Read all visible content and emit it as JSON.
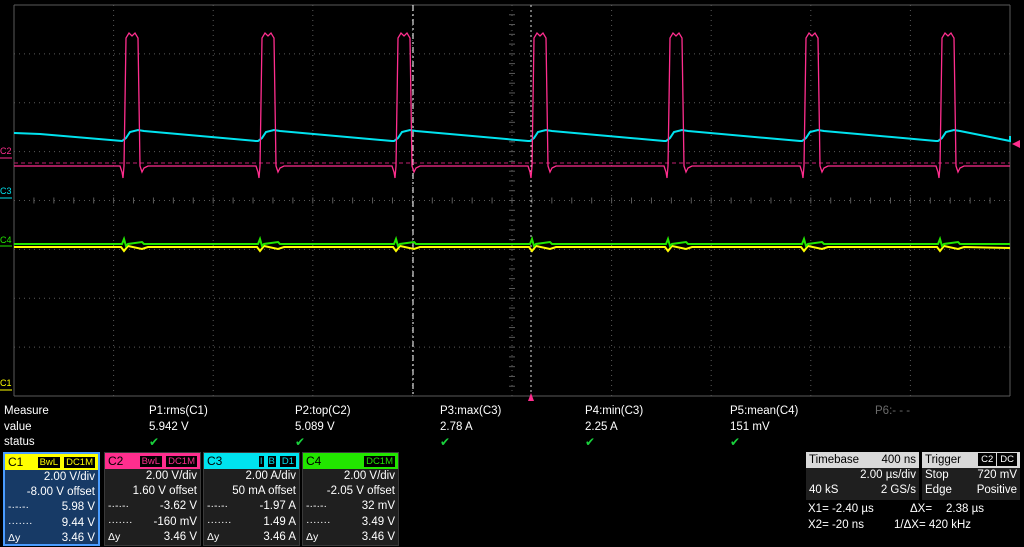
{
  "colors": {
    "c1": "#ffff00",
    "c2": "#ff2e8e",
    "c3": "#00e3ef",
    "c4": "#22e600",
    "grid": "#5a5a5a",
    "status_ok": "#19d23c"
  },
  "screen": {
    "markers": {
      "c2": "C2",
      "c3": "C3",
      "c4": "C4",
      "c1": "C1"
    }
  },
  "measure": {
    "header_label": "Measure",
    "value_label": "value",
    "status_label": "status",
    "params": [
      {
        "name": "P1:rms(C1)",
        "value": "5.942 V",
        "status": "✔"
      },
      {
        "name": "P2:top(C2)",
        "value": "5.089 V",
        "status": "✔"
      },
      {
        "name": "P3:max(C3)",
        "value": "2.78 A",
        "status": "✔"
      },
      {
        "name": "P4:min(C3)",
        "value": "2.25 A",
        "status": "✔"
      },
      {
        "name": "P5:mean(C4)",
        "value": "151 mV",
        "status": "✔"
      },
      {
        "name": "P6:- - -",
        "value": "",
        "status": ""
      }
    ]
  },
  "channels": [
    {
      "name": "C1",
      "badges": [
        "BwL",
        "DC1M"
      ],
      "vdiv": "2.00 V/div",
      "offset": "-8.00 V offset",
      "r1l": "-·-·-·",
      "r1": "5.98 V",
      "r2l": "·······",
      "r2": "9.44 V",
      "r3l": "Δy",
      "r3": "3.46 V"
    },
    {
      "name": "C2",
      "badges": [
        "BwL",
        "DC1M"
      ],
      "vdiv": "2.00 V/div",
      "offset": "1.60 V offset",
      "r1l": "-·-·-·",
      "r1": "-3.62 V",
      "r2l": "·······",
      "r2": "-160 mV",
      "r3l": "Δy",
      "r3": "3.46 V"
    },
    {
      "name": "C3",
      "badges": [
        "I",
        "B",
        "D1"
      ],
      "vdiv": "2.00 A/div",
      "offset": "50 mA offset",
      "r1l": "-·-·-·",
      "r1": "-1.97 A",
      "r2l": "·······",
      "r2": "1.49 A",
      "r3l": "Δy",
      "r3": "3.46 A"
    },
    {
      "name": "C4",
      "badges": [
        "DC1M"
      ],
      "vdiv": "2.00 V/div",
      "offset": "-2.05 V offset",
      "r1l": "-·-·-·",
      "r1": "32 mV",
      "r2l": "·······",
      "r2": "3.49 V",
      "r3l": "Δy",
      "r3": "3.46 V"
    }
  ],
  "timebase": {
    "label": "Timebase",
    "delay": "400 ns",
    "tdiv": "2.00 µs/div",
    "samples": "40 kS",
    "rate": "2 GS/s"
  },
  "trigger": {
    "label": "Trigger",
    "source": "C2",
    "coupling": "DC",
    "mode": "Stop",
    "level": "720 mV",
    "type": "Edge",
    "slope": "Positive"
  },
  "cursors": {
    "x1": "X1= -2.40 µs",
    "dx": "ΔX=",
    "dx_val": "2.38 µs",
    "x2": "X2= -20 ns",
    "inv_dx": "1/ΔX= 420 kHz"
  }
}
